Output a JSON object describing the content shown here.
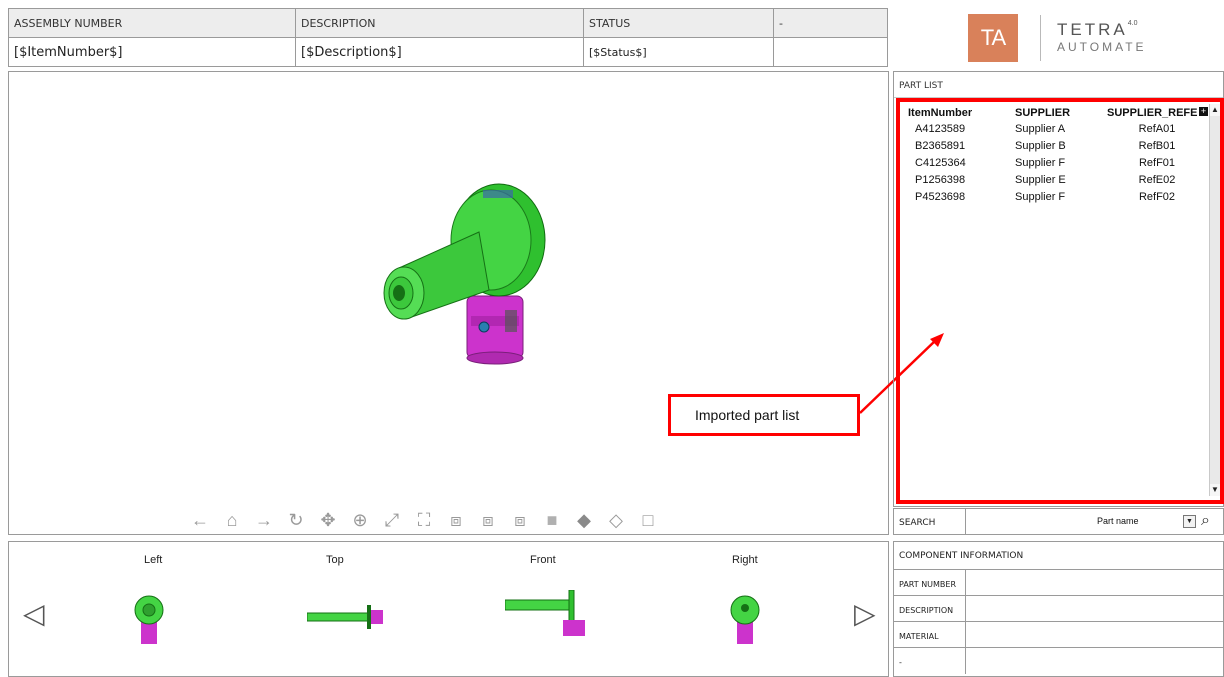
{
  "header": {
    "columns": [
      "ASSEMBLY NUMBER",
      "DESCRIPTION",
      "STATUS",
      "-"
    ],
    "values": [
      "[$ItemNumber$]",
      "[$Description$]",
      "[$Status$]",
      ""
    ]
  },
  "logo": {
    "mark": "TA",
    "name": "TETRA",
    "superscript": "4.0",
    "subtitle": "AUTOMATE",
    "color": "#d9815a"
  },
  "viewer": {
    "toolbar_icons": [
      "arrow-left-icon",
      "home-icon",
      "arrow-right-icon",
      "rotate-icon",
      "pan-icon",
      "zoom-window-icon",
      "fit-all-icon",
      "explode-icon",
      "view-iso-1-icon",
      "view-iso-2-icon",
      "view-iso-3-icon",
      "shaded-icon",
      "shaded-edges-icon",
      "wireframe-icon",
      "fullscreen-icon"
    ]
  },
  "callout": {
    "text": "Imported part list",
    "color": "#ff0000"
  },
  "part_list": {
    "title": "PART LIST",
    "columns": [
      "ItemNumber",
      "SUPPLIER",
      "SUPPLIER_REFE"
    ],
    "rows": [
      [
        "A4123589",
        "Supplier A",
        "RefA01"
      ],
      [
        "B2365891",
        "Supplier B",
        "RefB01"
      ],
      [
        "C4125364",
        "Supplier F",
        "RefF01"
      ],
      [
        "P1256398",
        "Supplier E",
        "RefE02"
      ],
      [
        "P4523698",
        "Supplier F",
        "RefF02"
      ]
    ]
  },
  "search": {
    "label": "SEARCH",
    "selected": "Part name"
  },
  "component_info": {
    "title": "COMPONENT INFORMATION",
    "fields": [
      "PART NUMBER",
      "DESCRIPTION",
      "MATERIAL",
      "-"
    ]
  },
  "views": [
    "Left",
    "Top",
    "Front",
    "Right"
  ]
}
